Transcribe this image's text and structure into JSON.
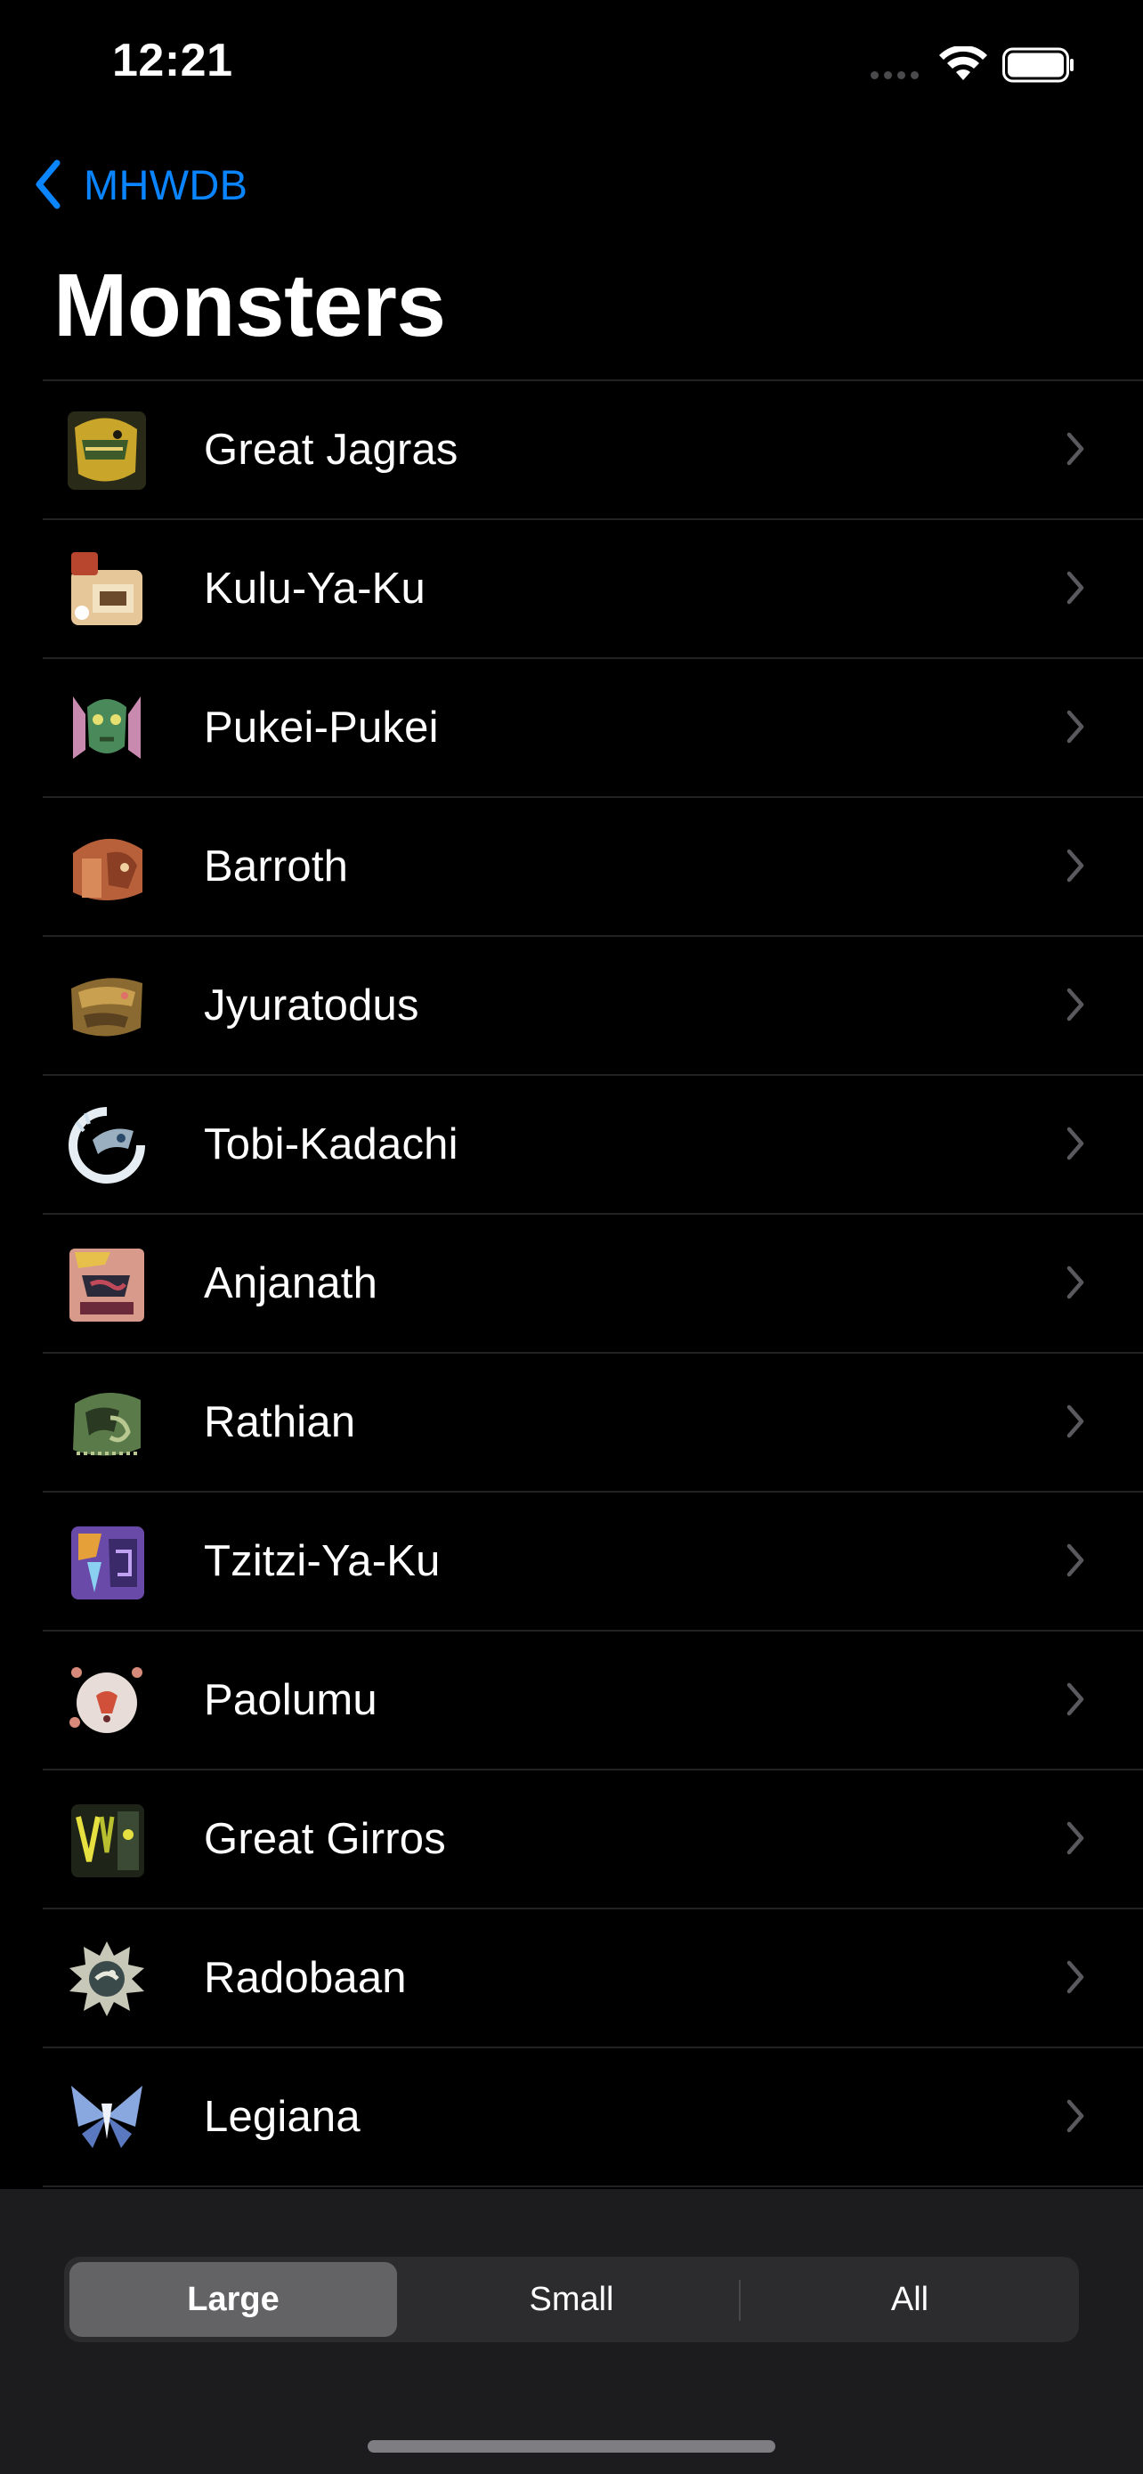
{
  "status_bar": {
    "time": "12:21"
  },
  "nav": {
    "back_label": "MHWDB"
  },
  "title": "Monsters",
  "monsters": [
    {
      "name": "Great Jagras",
      "icon": "great-jagras-icon"
    },
    {
      "name": "Kulu-Ya-Ku",
      "icon": "kulu-ya-ku-icon"
    },
    {
      "name": "Pukei-Pukei",
      "icon": "pukei-pukei-icon"
    },
    {
      "name": "Barroth",
      "icon": "barroth-icon"
    },
    {
      "name": "Jyuratodus",
      "icon": "jyuratodus-icon"
    },
    {
      "name": "Tobi-Kadachi",
      "icon": "tobi-kadachi-icon"
    },
    {
      "name": "Anjanath",
      "icon": "anjanath-icon"
    },
    {
      "name": "Rathian",
      "icon": "rathian-icon"
    },
    {
      "name": "Tzitzi-Ya-Ku",
      "icon": "tzitzi-ya-ku-icon"
    },
    {
      "name": "Paolumu",
      "icon": "paolumu-icon"
    },
    {
      "name": "Great Girros",
      "icon": "great-girros-icon"
    },
    {
      "name": "Radobaan",
      "icon": "radobaan-icon"
    },
    {
      "name": "Legiana",
      "icon": "legiana-icon"
    }
  ],
  "filter": {
    "options": [
      "Large",
      "Small",
      "All"
    ],
    "selected": "Large"
  },
  "colors": {
    "accent": "#0a84ff",
    "background": "#000000",
    "toolbar": "#1c1c1e",
    "segment_bg": "#2c2c2e",
    "segment_active": "#636366"
  }
}
